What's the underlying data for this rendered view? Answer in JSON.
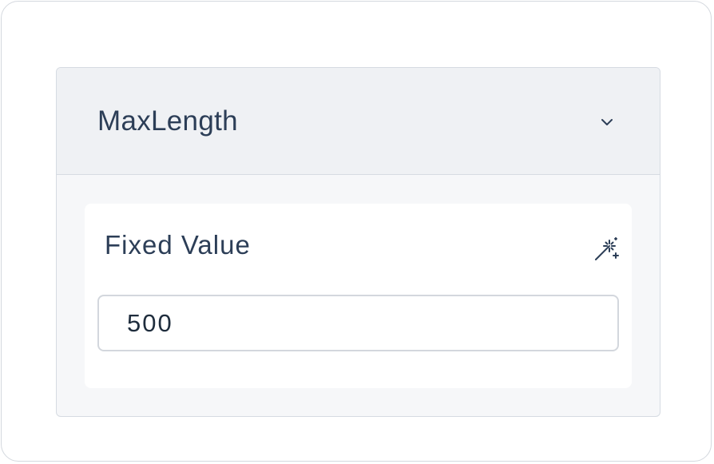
{
  "accordion": {
    "title": "MaxLength",
    "toggle_icon": "chevron-down-icon",
    "expanded": true
  },
  "field": {
    "label": "Fixed Value",
    "value": "500",
    "action_icon": "magic-wand-icon"
  },
  "colors": {
    "text": "#2c3e57",
    "header_bg": "#eff1f4",
    "panel_bg": "#f6f7f9",
    "border": "#d6dbe2",
    "card_bg": "#ffffff"
  }
}
